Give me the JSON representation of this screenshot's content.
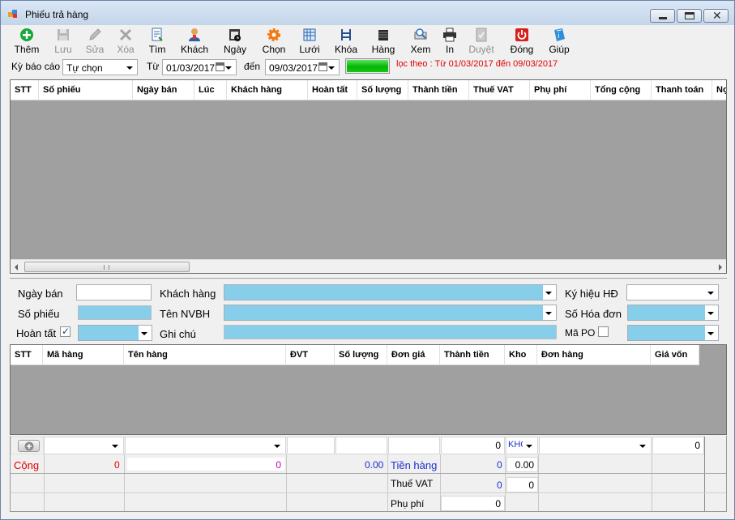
{
  "window": {
    "title": "Phiếu trả hàng"
  },
  "toolbar": [
    {
      "label": "Thêm",
      "icon": "add-icon",
      "enabled": true
    },
    {
      "label": "Lưu",
      "icon": "save-icon",
      "enabled": false
    },
    {
      "label": "Sửa",
      "icon": "edit-icon",
      "enabled": false
    },
    {
      "label": "Xóa",
      "icon": "delete-icon",
      "enabled": false
    },
    {
      "label": "Tìm",
      "icon": "find-icon",
      "enabled": true
    },
    {
      "label": "Khách",
      "icon": "customer-icon",
      "enabled": true
    },
    {
      "label": "Ngày",
      "icon": "calendar-icon",
      "enabled": true
    },
    {
      "label": "Chọn",
      "icon": "gear-icon",
      "enabled": true
    },
    {
      "label": "Lưới",
      "icon": "grid-icon",
      "enabled": true
    },
    {
      "label": "Khóa",
      "icon": "lock-icon",
      "enabled": true
    },
    {
      "label": "Hàng",
      "icon": "goods-icon",
      "enabled": true
    },
    {
      "label": "Xem",
      "icon": "view-icon",
      "enabled": true
    },
    {
      "label": "In",
      "icon": "printer-icon",
      "enabled": true
    },
    {
      "label": "Duyệt",
      "icon": "approve-icon",
      "enabled": false
    },
    {
      "label": "Đóng",
      "icon": "power-icon",
      "enabled": true
    },
    {
      "label": "Giúp",
      "icon": "help-icon",
      "enabled": true
    }
  ],
  "filter": {
    "period_label": "Kỳ báo cáo",
    "period_value": "Tự chọn",
    "from_label": "Từ",
    "from_date": "01/03/2017",
    "to_label": "đến",
    "to_date": "09/03/2017",
    "progress": 1.0,
    "status_text": "lọc theo : Từ 01/03/2017 đến 09/03/2017",
    "status_color": "#e00000"
  },
  "grid1": {
    "columns": [
      "STT",
      "Số phiếu",
      "Ngày bán",
      "Lúc",
      "Khách hàng",
      "Hoàn tất",
      "Số lượng",
      "Thành tiền",
      "Thuế VAT",
      "Phụ phí",
      "Tổng cộng",
      "Thanh toán",
      "Nợ"
    ],
    "rows": []
  },
  "form": {
    "ngay_ban_label": "Ngày bán",
    "ngay_ban_value": "",
    "so_phieu_label": "Số phiếu",
    "so_phieu_value": "",
    "hoan_tat_label": "Hoàn tất",
    "hoan_tat_checked": true,
    "hoan_tat_select": "",
    "khach_hang_label": "Khách hàng",
    "khach_hang_value": "",
    "ten_nvbh_label": "Tên NVBH",
    "ten_nvbh_value": "",
    "ghi_chu_label": "Ghi chú",
    "ghi_chu_value": "",
    "ky_hieu_hd_label": "Ký hiệu HĐ",
    "ky_hieu_hd_value": "",
    "so_hoa_don_label": "Số Hóa đơn",
    "so_hoa_don_value": "",
    "ma_po_label": "Mã PO",
    "ma_po_checked": false,
    "ma_po_value": ""
  },
  "grid2": {
    "columns": [
      "STT",
      "Mã hàng",
      "Tên hàng",
      "ĐVT",
      "Số lượng",
      "Đơn giá",
      "Thành tiền",
      "Kho",
      "Đơn hàng",
      "Giá vốn"
    ],
    "rows": []
  },
  "entry": {
    "add_icon": "plus-icon",
    "thanh_tien": "0",
    "kho": "KHO",
    "gia_von": "0"
  },
  "totals": {
    "cong_label": "Cộng",
    "ma_hang_total": "0",
    "ten_hang_total": "0",
    "don_gia_total": "0.00",
    "tien_hang_label": "Tiền hàng",
    "tien_hang": "0",
    "kho_total": "0.00",
    "thue_vat_label": "Thuế VAT",
    "thue_vat": "0",
    "thue_vat_kho": "0",
    "phu_phi_label": "Phụ phí",
    "phu_phi": "0"
  },
  "colors": {
    "accent_red": "#e00000",
    "magenta": "#c000c0",
    "blue_text": "#1c2fcf",
    "field_blue": "#87ceeb"
  }
}
